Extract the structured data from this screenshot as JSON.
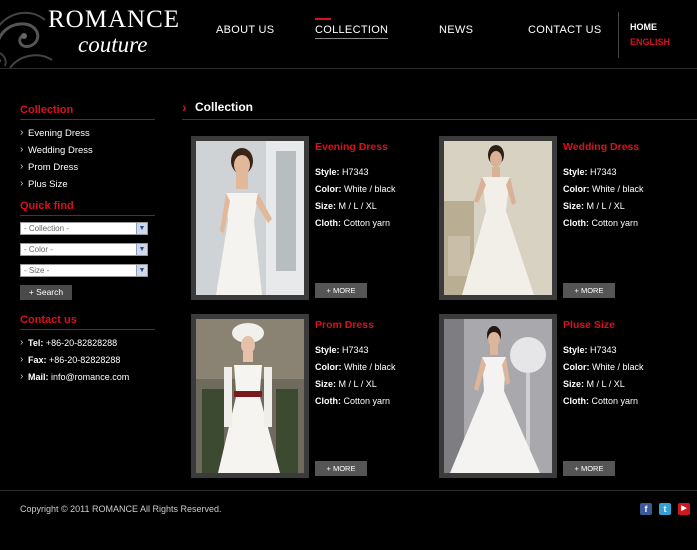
{
  "brand": {
    "line1": "ROMANCE",
    "line2": "couture"
  },
  "nav": [
    {
      "label": "ABOUT US",
      "active": false
    },
    {
      "label": "COLLECTION",
      "active": true
    },
    {
      "label": "NEWS",
      "active": false
    },
    {
      "label": "CONTACT US",
      "active": false
    }
  ],
  "lang": {
    "home": "HOME",
    "english": "ENGLISH"
  },
  "sidebar": {
    "collection_title": "Collection",
    "collection_items": [
      "Evening Dress",
      "Wedding Dress",
      "Prom Dress",
      "Plus Size"
    ],
    "quickfind_title": "Quick find",
    "selects": [
      "- Collection -",
      "- Color -",
      "- Size -"
    ],
    "search_label": "+ Search",
    "contact_title": "Contact us",
    "contacts": [
      {
        "label": "Tel:",
        "value": "+86-20-82828288"
      },
      {
        "label": "Fax:",
        "value": "+86-20-82828288"
      },
      {
        "label": "Mail:",
        "value": "info@romance.com"
      }
    ]
  },
  "main": {
    "title": "Collection",
    "more_label": "+ MORE",
    "products": [
      {
        "name": "Evening Dress",
        "style": "H7343",
        "color": "White / black",
        "size": "M / L / XL",
        "cloth": "Cotton yarn"
      },
      {
        "name": "Wedding Dress",
        "style": "H7343",
        "color": "White / black",
        "size": "M / L / XL",
        "cloth": "Cotton yarn"
      },
      {
        "name": "Prom Dress",
        "style": "H7343",
        "color": "White / black",
        "size": "M / L / XL",
        "cloth": "Cotton yarn"
      },
      {
        "name": "Pluse Size",
        "style": "H7343",
        "color": "White / black",
        "size": "M / L / XL",
        "cloth": "Cotton yarn"
      }
    ],
    "labels": {
      "style": "Style:",
      "color": "Color:",
      "size": "Size:",
      "cloth": "Cloth:"
    }
  },
  "footer": {
    "copyright": "Copyright © 2011 ROMANCE All Rights Reserved."
  },
  "social": [
    {
      "icon": "facebook-icon",
      "glyph": "f",
      "color": "#3b5998"
    },
    {
      "icon": "twitter-icon",
      "glyph": "t",
      "color": "#33a1d6"
    },
    {
      "icon": "youtube-icon",
      "glyph": "▶",
      "color": "#cc181e"
    }
  ],
  "colors": {
    "accent": "#d6121f",
    "background": "#000000"
  }
}
